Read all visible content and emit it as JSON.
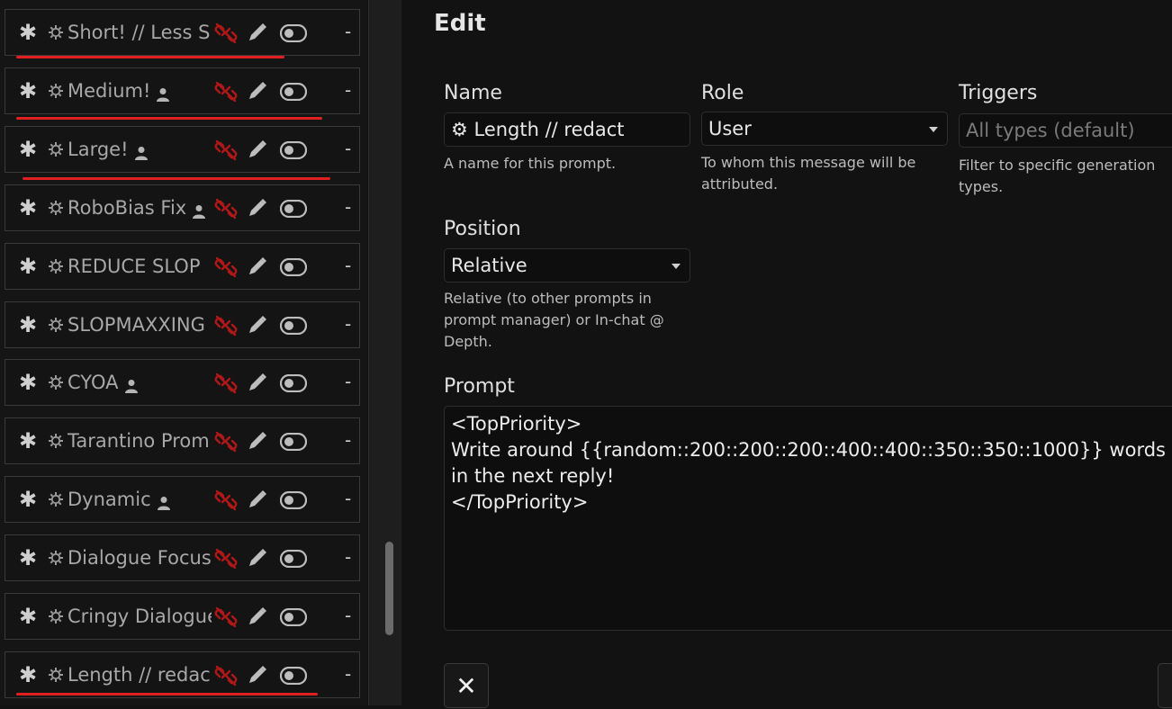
{
  "prompt_list": [
    {
      "label": "Short! // Less Sl",
      "has_user_icon": false
    },
    {
      "label": "Medium!",
      "has_user_icon": true
    },
    {
      "label": "Large!",
      "has_user_icon": true
    },
    {
      "label": "RoboBias Fix",
      "has_user_icon": true
    },
    {
      "label": "REDUCE SLOP",
      "has_user_icon": false
    },
    {
      "label": "SLOPMAXXING",
      "has_user_icon": false
    },
    {
      "label": "CYOA",
      "has_user_icon": true
    },
    {
      "label": "Tarantino Prom",
      "has_user_icon": false
    },
    {
      "label": "Dynamic",
      "has_user_icon": true
    },
    {
      "label": "Dialogue Focus",
      "has_user_icon": false
    },
    {
      "label": "Cringy Dialogue",
      "has_user_icon": false
    },
    {
      "label": "Length // redac",
      "has_user_icon": false
    }
  ],
  "row_controls": {
    "drag": "✱",
    "remove": "-"
  },
  "icons": {
    "drag": "asterisk-icon",
    "gear": "gear-icon",
    "user": "user-icon",
    "unlink": "unlink-icon",
    "edit": "pencil-icon",
    "toggle": "toggle-icon"
  },
  "colors": {
    "accent_red": "#e02020",
    "unlink_red": "#b01818"
  },
  "edit": {
    "title": "Edit",
    "name": {
      "label": "Name",
      "value": "⚙ Length // redact",
      "help": "A name for this prompt."
    },
    "role": {
      "label": "Role",
      "value": "User",
      "help": "To whom this message will be attributed."
    },
    "triggers": {
      "label": "Triggers",
      "placeholder": "All types (default)",
      "help": "Filter to specific generation types."
    },
    "position": {
      "label": "Position",
      "value": "Relative",
      "help": "Relative (to other prompts in prompt manager) or In-chat @ Depth."
    },
    "prompt": {
      "label": "Prompt",
      "value": "<TopPriority>\nWrite around {{random::200::200::200::400::400::350::350::1000}} words in the next reply!\n</TopPriority>"
    },
    "close_button": "✕"
  }
}
